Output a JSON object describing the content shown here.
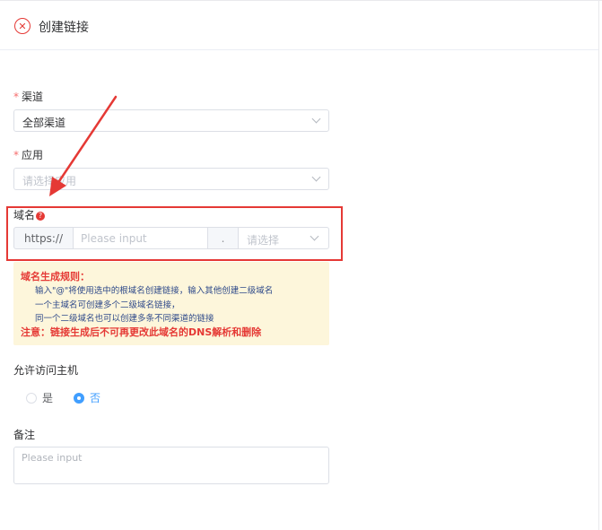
{
  "header": {
    "title": "创建链接"
  },
  "channel": {
    "label": "渠道",
    "required_mark": "*",
    "value": "全部渠道"
  },
  "app": {
    "label": "应用",
    "required_mark": "*",
    "placeholder": "请选择应用"
  },
  "domain": {
    "label": "域名",
    "help_icon_glyph": "?",
    "prefix": "https://",
    "input_placeholder": "Please input",
    "separator": ".",
    "select_placeholder": "请选择"
  },
  "rules": {
    "title": "域名生成规则：",
    "line1": "输入\"@\"将使用选中的根域名创建链接，输入其他创建二级域名",
    "line2": "一个主域名可创建多个二级域名链接，",
    "line3": "同一个二级域名也可以创建多条不同渠道的链接",
    "note": "注意：链接生成后不可再更改此域名的DNS解析和删除"
  },
  "allow_host": {
    "label": "允许访问主机",
    "options": [
      "是",
      "否"
    ],
    "selected": "否"
  },
  "remark": {
    "label": "备注",
    "placeholder": "Please input"
  },
  "colors": {
    "accent": "#409eff",
    "annotation_red": "#e53935",
    "notice_bg": "#fdf6db"
  }
}
